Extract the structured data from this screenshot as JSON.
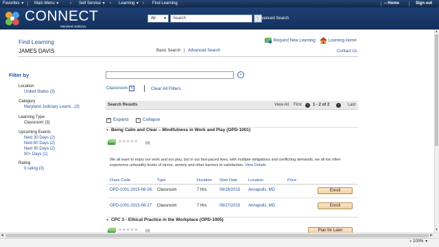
{
  "topnav": {
    "favorites": "Favorites",
    "main_menu": "Main Menu",
    "self_service": "Self Service",
    "learning": "Learning",
    "find_learning": "Find Learning",
    "home": "Home",
    "sign_out": "Sign out"
  },
  "header": {
    "brand": "CONNECT",
    "brand_sub": "Maryland Judiciary",
    "search_scope": "All",
    "search_placeholder": "Search",
    "advanced_search": "Advanced Search"
  },
  "subheader": {
    "page_title": "Find Learning",
    "user_name": "JAMES DAVIS",
    "basic_search": "Basic Search",
    "separator": "|",
    "advanced_search": "Advanced Search",
    "request_new_learning": "Request New Learning",
    "learning_home": "Learning Home",
    "contact_us": "Contact Us"
  },
  "filters": {
    "title": "Filter by",
    "location": {
      "heading": "Location",
      "values": [
        "United States (3)"
      ]
    },
    "category": {
      "heading": "Category",
      "values": [
        "Maryland Judiciary Learni...(3)"
      ]
    },
    "learning_type": {
      "heading": "Learning Type",
      "values": [
        "Classroom (3)"
      ]
    },
    "upcoming_events": {
      "heading": "Upcoming Events",
      "values": [
        "Next 30 Days (2)",
        "Next 60 Days (2)",
        "Next 90 Days (2)",
        "90+ Days (1)"
      ]
    },
    "rating": {
      "heading": "Rating",
      "values": [
        "0 rating (3)"
      ]
    }
  },
  "main": {
    "selected_filter": "Classroom",
    "clear_all": "Clear All Filters",
    "results_label": "Search Results",
    "view_all": "View All",
    "first": "First",
    "range": "1 - 2 of 2",
    "last": "Last",
    "expand": "Expand",
    "collapse": "Collapse"
  },
  "courses": [
    {
      "title": "Being Calm and Clear – Mindfulness in Work and Play (OPD-1001)",
      "rating_count": "(0)",
      "rating": 0,
      "description": "We all want to enjoy our work and our play, but in our fast-paced lives, with multiple obligations and conflicting demands, we all too often experience unhealthy levels of stress, anxiety and other barriers to satisfaction.",
      "view_details": "View Details",
      "columns": [
        "Class Code",
        "Type",
        "Duration",
        "Start Date",
        "Location",
        "Price"
      ],
      "classes": [
        {
          "code": "OPD-1001-2015-08-26",
          "type": "Classroom",
          "duration": "7 Hrs",
          "start": "08/26/2015",
          "location": "Annapolis, MD",
          "price": "",
          "action": "Enroll"
        },
        {
          "code": "OPD-1001-2015-08-27",
          "type": "Classroom",
          "duration": "7 Hrs",
          "start": "08/27/2015",
          "location": "Annapolis, MD",
          "price": "",
          "action": "Enroll"
        }
      ]
    },
    {
      "title": "CPC 3 - Ethical Practice in the Workplace (OPD-1005)",
      "rating_count": "(0)",
      "rating": 0,
      "action": "Plan for Later"
    }
  ],
  "status": {
    "zoom": "100%"
  },
  "colors": {
    "header_bg": "#1e3f72",
    "link": "#1f4e9c",
    "button": "#f2cfa0",
    "book_icon": "#3c8a3c"
  }
}
